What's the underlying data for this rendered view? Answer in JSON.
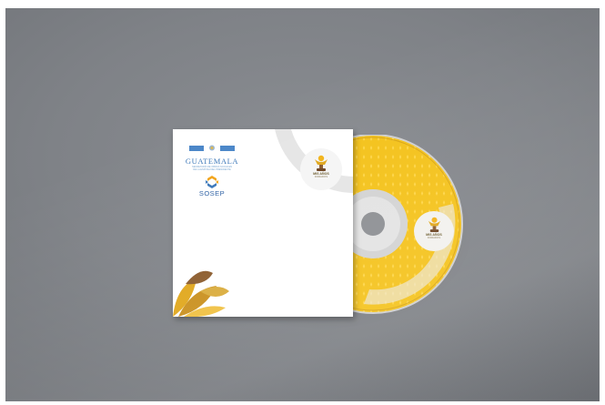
{
  "scene": {
    "description_colors": {
      "background": "#7f8287",
      "disc_yellow": "#f4c21a",
      "accent_brown": "#8a5a2b",
      "blue": "#3b77b8"
    }
  },
  "sleeve": {
    "logo_country": "GUATEMALA",
    "logo_subtitle_1": "SECRETARÍA DE OBRAS SOCIALES",
    "logo_subtitle_2": "DE LA ESPOSA DEL PRESIDENTE",
    "logo_org": "SOSEP",
    "badge_title": "MIS AÑOS",
    "badge_subtitle": "DORADOS"
  },
  "disc": {
    "badge_title": "MIS AÑOS",
    "badge_subtitle": "DORADOS"
  }
}
